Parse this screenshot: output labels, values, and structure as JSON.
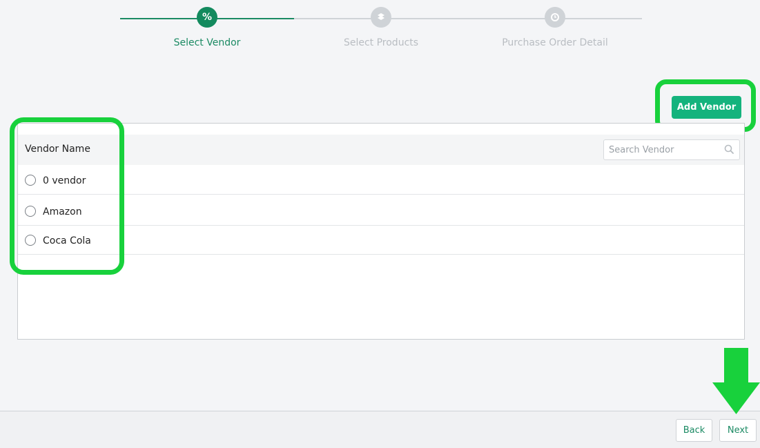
{
  "stepper": {
    "steps": [
      {
        "label": "Select Vendor",
        "icon": "%",
        "active": true
      },
      {
        "label": "Select Products",
        "icon": "box-icon",
        "active": false
      },
      {
        "label": "Purchase Order Detail",
        "icon": "clock-icon",
        "active": false
      }
    ]
  },
  "toolbar": {
    "add_vendor_label": "Add Vendor"
  },
  "table": {
    "header": "Vendor Name",
    "search_placeholder": "Search Vendor",
    "rows": [
      {
        "name": "0 vendor"
      },
      {
        "name": "Amazon"
      },
      {
        "name": "Coca Cola"
      }
    ]
  },
  "footer": {
    "back_label": "Back",
    "next_label": "Next"
  },
  "colors": {
    "accent": "#14b37d",
    "active_step": "#138a5e",
    "highlight": "#18d13c"
  }
}
